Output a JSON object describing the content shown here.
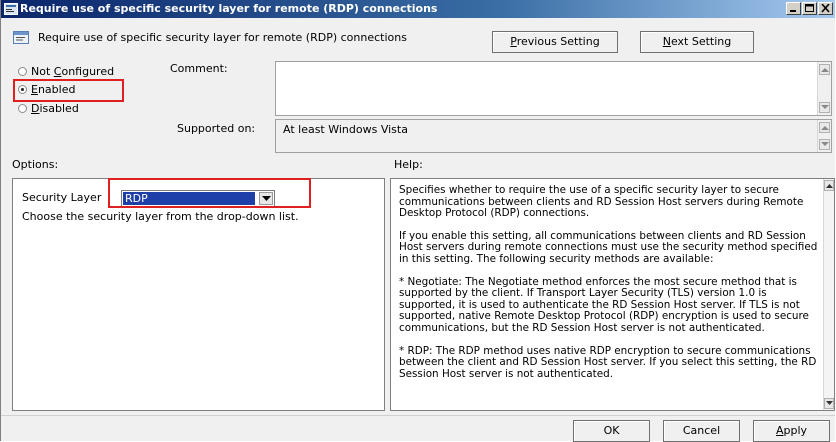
{
  "window": {
    "title": "Require use of specific security layer for remote (RDP) connections"
  },
  "header": {
    "policy_name": "Require use of specific security layer for remote (RDP) connections",
    "previous_button": {
      "prefix": "",
      "accel": "P",
      "rest": "revious Setting"
    },
    "next_button": {
      "prefix": "",
      "accel": "N",
      "rest": "ext Setting"
    }
  },
  "state": {
    "not_configured": {
      "prefix": "Not ",
      "accel": "C",
      "rest": "onfigured",
      "selected": false
    },
    "enabled": {
      "prefix": "",
      "accel": "E",
      "rest": "nabled",
      "selected": true
    },
    "disabled": {
      "prefix": "",
      "accel": "D",
      "rest": "isabled",
      "selected": false
    }
  },
  "comment": {
    "label": "Comment:",
    "value": ""
  },
  "supported_on": {
    "label": "Supported on:",
    "value": "At least Windows Vista"
  },
  "options": {
    "label": "Options:",
    "security_layer_label": "Security Layer",
    "security_layer_value": "RDP",
    "instruction": "Choose the security layer from the drop-down list."
  },
  "help": {
    "label": "Help:",
    "paragraphs": [
      "Specifies whether to require the use of a specific security layer to secure communications between clients and RD Session Host servers during Remote Desktop Protocol (RDP) connections.",
      "If you enable this setting, all communications between clients and RD Session Host servers during remote connections must use the security method specified in this setting. The following security methods are available:",
      "* Negotiate: The Negotiate method enforces the most secure method that is supported by the client. If Transport Layer Security (TLS) version 1.0 is supported, it is used to authenticate the RD Session Host server. If TLS is not supported, native Remote Desktop Protocol (RDP) encryption is used to secure communications, but the RD Session Host server is not authenticated.",
      "* RDP: The RDP method uses native RDP encryption to secure communications between the client and RD Session Host server. If you select this setting, the RD Session Host server is not authenticated."
    ]
  },
  "footer": {
    "ok": "OK",
    "cancel": "Cancel",
    "apply": {
      "prefix": "",
      "accel": "A",
      "rest": "pply"
    }
  },
  "colors": {
    "highlight_box": "#e02020",
    "selection": "#1f3fa8",
    "titlebar": "#0a246a"
  }
}
